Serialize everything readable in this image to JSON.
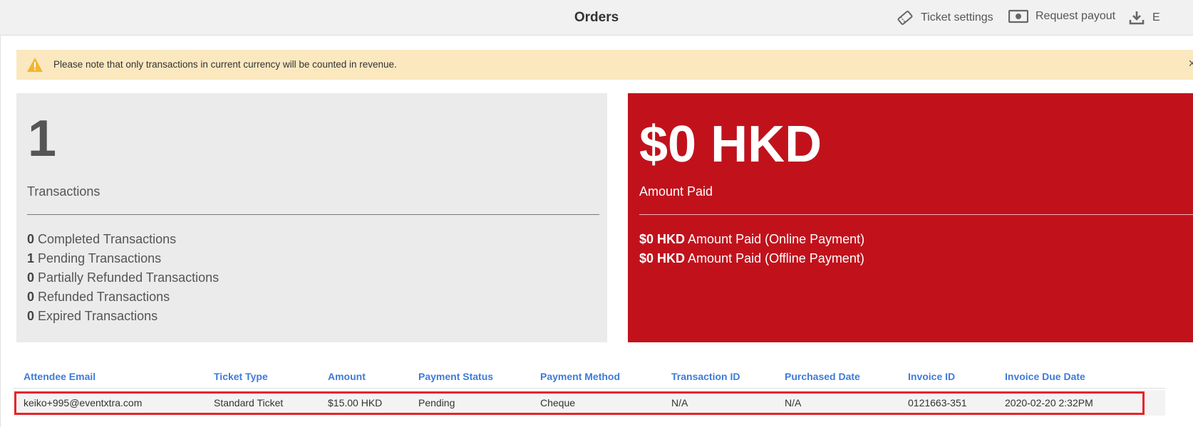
{
  "header": {
    "title": "Orders",
    "actions": [
      {
        "label": "Ticket settings",
        "icon": "ticket-icon"
      },
      {
        "label": "Request payout",
        "icon": "money-icon"
      },
      {
        "label": "E",
        "icon": "download-icon"
      }
    ]
  },
  "notice": {
    "text": "Please note that only transactions in current currency will be counted in revenue.",
    "icon": "warning-icon",
    "close": "×"
  },
  "summary_left": {
    "count": "1",
    "label": "Transactions",
    "items": [
      {
        "value": "0",
        "label": "Completed Transactions"
      },
      {
        "value": "1",
        "label": "Pending Transactions"
      },
      {
        "value": "0",
        "label": "Partially Refunded Transactions"
      },
      {
        "value": "0",
        "label": "Refunded Transactions"
      },
      {
        "value": "0",
        "label": "Expired Transactions"
      }
    ]
  },
  "summary_right": {
    "amount": "$0 HKD",
    "label": "Amount Paid",
    "items": [
      {
        "value": "$0 HKD",
        "label": "Amount Paid (Online Payment)"
      },
      {
        "value": "$0 HKD",
        "label": "Amount Paid (Offline Payment)"
      }
    ],
    "color": "#c1121c"
  },
  "table": {
    "columns": [
      "Attendee Email",
      "Ticket Type",
      "Amount",
      "Payment Status",
      "Payment Method",
      "Transaction ID",
      "Purchased Date",
      "Invoice ID",
      "Invoice Due Date"
    ],
    "rows": [
      [
        "keiko+995@eventxtra.com",
        "Standard Ticket",
        "$15.00 HKD",
        "Pending",
        "Cheque",
        "N/A",
        "N/A",
        "0121663-351",
        "2020-02-20 2:32PM"
      ]
    ],
    "header_color": "#3e7bd8",
    "highlight_color": "#e8252b"
  }
}
